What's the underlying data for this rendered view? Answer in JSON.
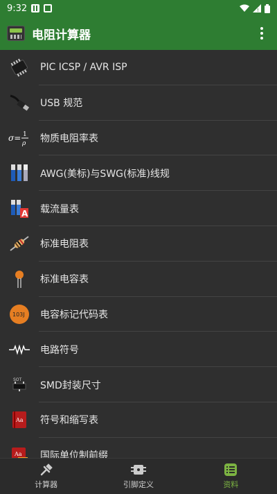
{
  "status": {
    "time": "9:32"
  },
  "app": {
    "title": "电阻计算器"
  },
  "items": [
    {
      "label": "PIC ICSP / AVR ISP",
      "icon": "chip-icon"
    },
    {
      "label": "USB 规范",
      "icon": "usb-cable-icon"
    },
    {
      "label": "物质电阻率表",
      "icon": "resistivity-formula-icon"
    },
    {
      "label": "AWG(美标)与SWG(标准)线规",
      "icon": "wire-gauge-icon"
    },
    {
      "label": "载流量表",
      "icon": "ampacity-icon"
    },
    {
      "label": "标准电阻表",
      "icon": "resistor-icon"
    },
    {
      "label": "标准电容表",
      "icon": "capacitor-icon"
    },
    {
      "label": "电容标记代码表",
      "icon": "capacitor-code-icon"
    },
    {
      "label": "电路符号",
      "icon": "circuit-symbol-icon"
    },
    {
      "label": "SMD封装尺寸",
      "icon": "smd-package-icon"
    },
    {
      "label": "符号和缩写表",
      "icon": "book-icon"
    },
    {
      "label": "国际单位制前缀",
      "icon": "si-prefix-book-icon"
    }
  ],
  "nav": [
    {
      "label": "计算器",
      "icon": "calculator-tools-icon"
    },
    {
      "label": "引脚定义",
      "icon": "pinout-icon"
    },
    {
      "label": "资料",
      "icon": "reference-list-icon"
    }
  ],
  "colors": {
    "primary": "#2e7d32",
    "accent": "#7cb342"
  }
}
